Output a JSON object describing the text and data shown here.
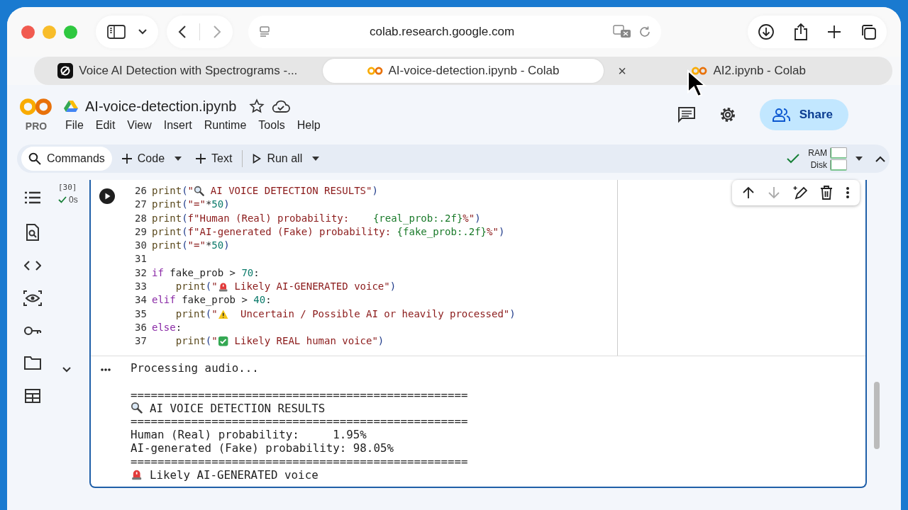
{
  "browser": {
    "url": "colab.research.google.com",
    "tabs": [
      {
        "title": "Voice AI Detection with Spectrograms -...",
        "selected": false,
        "kind": "app"
      },
      {
        "title": "AI-voice-detection.ipynb - Colab",
        "selected": true,
        "kind": "colab"
      },
      {
        "title": "AI2.ipynb - Colab",
        "selected": false,
        "kind": "colab",
        "close": "×"
      }
    ]
  },
  "notebook": {
    "logo_badge": "PRO",
    "title": "AI-voice-detection.ipynb",
    "starred": false,
    "menu": [
      "File",
      "Edit",
      "View",
      "Insert",
      "Runtime",
      "Tools",
      "Help"
    ],
    "share": "Share"
  },
  "toolbar": {
    "commands": "Commands",
    "add_code": "Code",
    "add_text": "Text",
    "run_all": "Run all",
    "connected": true,
    "resources": [
      {
        "label": "RAM",
        "level": 0.03
      },
      {
        "label": "Disk",
        "level": 0.03
      }
    ]
  },
  "cell": {
    "execution_count": "[30]",
    "duration": "0s",
    "code_lines": [
      {
        "number": "26",
        "segments": [
          {
            "kind": "fn",
            "text": "print"
          },
          {
            "kind": "punc",
            "text": "("
          },
          {
            "kind": "str",
            "text": "\""
          },
          {
            "kind": "icon-search"
          },
          {
            "kind": "str",
            "text": " AI VOICE DETECTION RESULTS\""
          },
          {
            "kind": "punc",
            "text": ")"
          }
        ]
      },
      {
        "number": "27",
        "segments": [
          {
            "kind": "fn",
            "text": "print"
          },
          {
            "kind": "punc",
            "text": "("
          },
          {
            "kind": "str",
            "text": "\"=\""
          },
          {
            "kind": "plain",
            "text": "*"
          },
          {
            "kind": "num",
            "text": "50"
          },
          {
            "kind": "punc",
            "text": ")"
          }
        ]
      },
      {
        "number": "28",
        "segments": [
          {
            "kind": "fn",
            "text": "print"
          },
          {
            "kind": "punc",
            "text": "("
          },
          {
            "kind": "str",
            "text": "f\"Human (Real) probability:    "
          },
          {
            "kind": "fmt",
            "text": "{real_prob:.2f}"
          },
          {
            "kind": "str",
            "text": "%\""
          },
          {
            "kind": "punc",
            "text": ")"
          }
        ]
      },
      {
        "number": "29",
        "segments": [
          {
            "kind": "fn",
            "text": "print"
          },
          {
            "kind": "punc",
            "text": "("
          },
          {
            "kind": "str",
            "text": "f\"AI-generated (Fake) probability: "
          },
          {
            "kind": "fmt",
            "text": "{fake_prob:.2f}"
          },
          {
            "kind": "str",
            "text": "%\""
          },
          {
            "kind": "punc",
            "text": ")"
          }
        ]
      },
      {
        "number": "30",
        "segments": [
          {
            "kind": "fn",
            "text": "print"
          },
          {
            "kind": "punc",
            "text": "("
          },
          {
            "kind": "str",
            "text": "\"=\""
          },
          {
            "kind": "plain",
            "text": "*"
          },
          {
            "kind": "num",
            "text": "50"
          },
          {
            "kind": "punc",
            "text": ")"
          }
        ]
      },
      {
        "number": "31"
      },
      {
        "number": "32",
        "segments": [
          {
            "kind": "kw",
            "text": "if"
          },
          {
            "kind": "plain",
            "text": " fake_prob > "
          },
          {
            "kind": "num",
            "text": "70"
          },
          {
            "kind": "plain",
            "text": ":"
          }
        ]
      },
      {
        "number": "33",
        "segments": [
          {
            "kind": "fn",
            "text": "    print"
          },
          {
            "kind": "punc",
            "text": "("
          },
          {
            "kind": "str",
            "text": "\""
          },
          {
            "kind": "icon-siren"
          },
          {
            "kind": "str",
            "text": " Likely AI-GENERATED voice\""
          },
          {
            "kind": "punc",
            "text": ")"
          }
        ]
      },
      {
        "number": "34",
        "segments": [
          {
            "kind": "kw",
            "text": "elif"
          },
          {
            "kind": "plain",
            "text": " fake_prob > "
          },
          {
            "kind": "num",
            "text": "40"
          },
          {
            "kind": "plain",
            "text": ":"
          }
        ]
      },
      {
        "number": "35",
        "segments": [
          {
            "kind": "fn",
            "text": "    print"
          },
          {
            "kind": "punc",
            "text": "("
          },
          {
            "kind": "str",
            "text": "\""
          },
          {
            "kind": "icon-warning"
          },
          {
            "kind": "str",
            "text": "  Uncertain / Possible AI or heavily processed\""
          },
          {
            "kind": "punc",
            "text": ")"
          }
        ]
      },
      {
        "number": "36",
        "segments": [
          {
            "kind": "kw",
            "text": "else"
          },
          {
            "kind": "plain",
            "text": ":"
          }
        ]
      },
      {
        "number": "37",
        "segments": [
          {
            "kind": "fn",
            "text": "    print"
          },
          {
            "kind": "punc",
            "text": "("
          },
          {
            "kind": "str",
            "text": "\""
          },
          {
            "kind": "icon-check"
          },
          {
            "kind": "str",
            "text": " Likely REAL human voice\""
          },
          {
            "kind": "punc",
            "text": ")"
          }
        ]
      }
    ],
    "output_lines": [
      {
        "segments": [
          {
            "kind": "plain",
            "text": "Processing audio..."
          }
        ]
      },
      {
        "blank": true
      },
      {
        "segments": [
          {
            "kind": "plain",
            "text": "=================================================="
          }
        ]
      },
      {
        "segments": [
          {
            "kind": "icon-search"
          },
          {
            "kind": "plain",
            "text": " AI VOICE DETECTION RESULTS"
          }
        ]
      },
      {
        "segments": [
          {
            "kind": "plain",
            "text": "=================================================="
          }
        ]
      },
      {
        "segments": [
          {
            "kind": "plain",
            "text": "Human (Real) probability:     1.95%"
          }
        ]
      },
      {
        "segments": [
          {
            "kind": "plain",
            "text": "AI-generated (Fake) probability: 98.05%"
          }
        ]
      },
      {
        "segments": [
          {
            "kind": "plain",
            "text": "=================================================="
          }
        ]
      },
      {
        "segments": [
          {
            "kind": "icon-siren"
          },
          {
            "kind": "plain",
            "text": " Likely AI-GENERATED voice"
          }
        ]
      }
    ]
  }
}
